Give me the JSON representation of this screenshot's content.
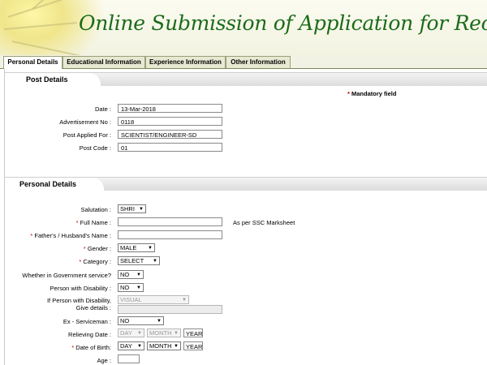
{
  "banner": {
    "title": "Online Submission of Application for Recruitment"
  },
  "tabs": [
    {
      "label": "Personal Details",
      "active": true
    },
    {
      "label": "Educational Information",
      "active": false
    },
    {
      "label": "Experience Information",
      "active": false
    },
    {
      "label": "Other Information",
      "active": false
    }
  ],
  "post": {
    "heading": "Post Details",
    "mandatory_star": "*",
    "mandatory_label": "Mandatory field",
    "date_label": "Date :",
    "date_value": "13-Mar-2018",
    "adv_label": "Advertisement No :",
    "adv_value": "0118",
    "applied_label": "Post Applied For :",
    "applied_value": "SCIENTIST/ENGINEER-SD",
    "code_label": "Post Code :",
    "code_value": "01"
  },
  "personal": {
    "heading": "Personal Details",
    "star": "*",
    "salutation_label": "Salutation :",
    "salutation_value": "SHRI",
    "fullname_label": "Full Name :",
    "fullname_note": "As per SSC Marksheet",
    "father_label": "Father's / Husband's Name :",
    "gender_label": "Gender :",
    "gender_value": "MALE",
    "category_label": "Category :",
    "category_value": "SELECT",
    "govt_label": "Whether in Government service?",
    "govt_value": "NO",
    "disability_label": "Person with Disability :",
    "disability_value": "NO",
    "disability_detail_label_1": "If Person with Disability,",
    "disability_detail_label_2": "Give details :",
    "disability_type_value": "VISUAL",
    "exservice_label": "Ex - Serviceman :",
    "exservice_value": "NO",
    "relieving_label": "Relieving Date :",
    "day": "DAY",
    "month": "MONTH",
    "year": "YEAR",
    "dob_label": "Date of Birth:",
    "age_label": "Age :"
  }
}
